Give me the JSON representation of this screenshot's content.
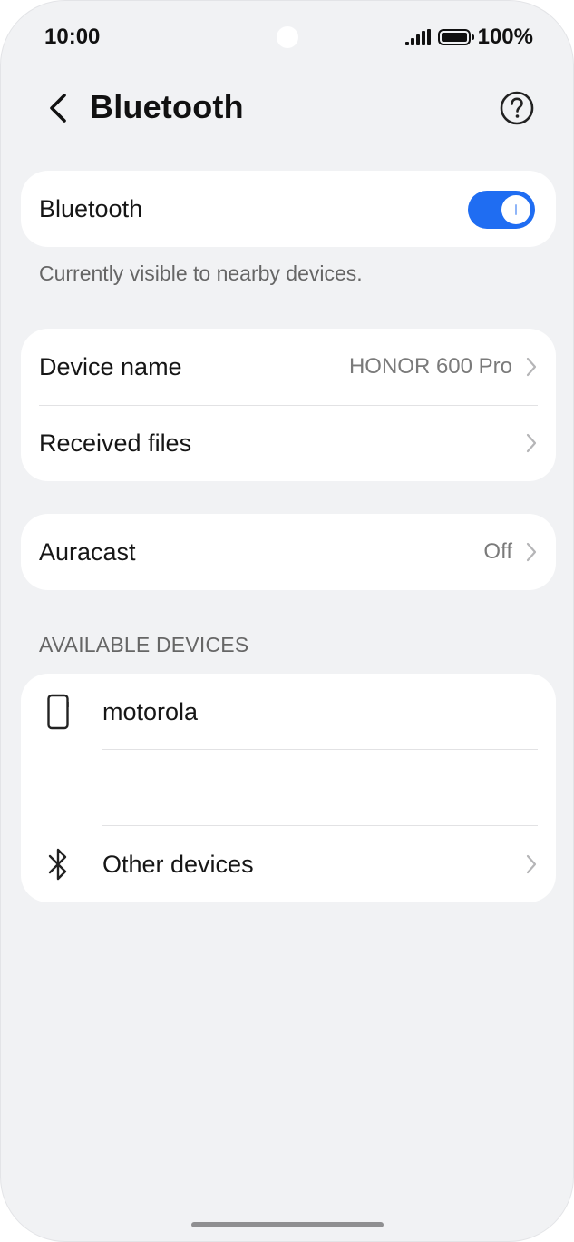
{
  "status_bar": {
    "time": "10:00",
    "battery": "100%"
  },
  "header": {
    "title": "Bluetooth"
  },
  "bluetooth": {
    "label": "Bluetooth",
    "enabled": true,
    "caption": "Currently visible to nearby devices."
  },
  "settings": {
    "device_name_label": "Device name",
    "device_name_value": "HONOR 600 Pro",
    "received_files_label": "Received files"
  },
  "auracast": {
    "label": "Auracast",
    "value": "Off"
  },
  "available_devices": {
    "header": "AVAILABLE DEVICES",
    "items": [
      {
        "label": "motorola",
        "icon": "phone-icon"
      },
      {
        "label": "Other devices",
        "icon": "bluetooth-icon"
      }
    ]
  },
  "colors": {
    "accent": "#1f6df2",
    "background": "#f1f2f4",
    "card": "#ffffff"
  }
}
